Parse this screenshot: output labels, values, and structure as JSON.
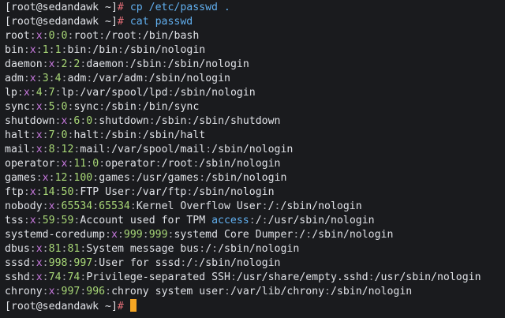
{
  "terminal": {
    "prompt": "[root@sedandawk ~]",
    "prompt_symbol": "#",
    "commands": [
      "cp /etc/passwd .",
      "cat passwd"
    ],
    "passwd_lines": [
      "root:x:0:0:root:/root:/bin/bash",
      "bin:x:1:1:bin:/bin:/sbin/nologin",
      "daemon:x:2:2:daemon:/sbin:/sbin/nologin",
      "adm:x:3:4:adm:/var/adm:/sbin/nologin",
      "lp:x:4:7:lp:/var/spool/lpd:/sbin/nologin",
      "sync:x:5:0:sync:/sbin:/bin/sync",
      "shutdown:x:6:0:shutdown:/sbin:/sbin/shutdown",
      "halt:x:7:0:halt:/sbin:/sbin/halt",
      "mail:x:8:12:mail:/var/spool/mail:/sbin/nologin",
      "operator:x:11:0:operator:/root:/sbin/nologin",
      "games:x:12:100:games:/usr/games:/sbin/nologin",
      "ftp:x:14:50:FTP User:/var/ftp:/sbin/nologin",
      "nobody:x:65534:65534:Kernel Overflow User:/:/sbin/nologin",
      "tss:x:59:59:Account used for TPM access:/:/usr/sbin/nologin",
      "systemd-coredump:x:999:999:systemd Core Dumper:/:/sbin/nologin",
      "dbus:x:81:81:System message bus:/:/sbin/nologin",
      "sssd:x:998:997:User for sssd:/:/sbin/nologin",
      "sshd:x:74:74:Privilege-separated SSH:/usr/share/empty.sshd:/usr/sbin/nologin",
      "chrony:x:997:996:chrony system user:/var/lib/chrony:/sbin/nologin"
    ]
  },
  "colors": {
    "background": "#1a1b1e",
    "text": "#dfe1e6",
    "prompt_symbol": "#e06c75",
    "command": "#61afef",
    "separator": "#a6a6ad",
    "x_field": "#c678dd",
    "uid_gid": "#a7d676",
    "gecos_keyword": "#61afef",
    "cursor": "#f5a623"
  }
}
